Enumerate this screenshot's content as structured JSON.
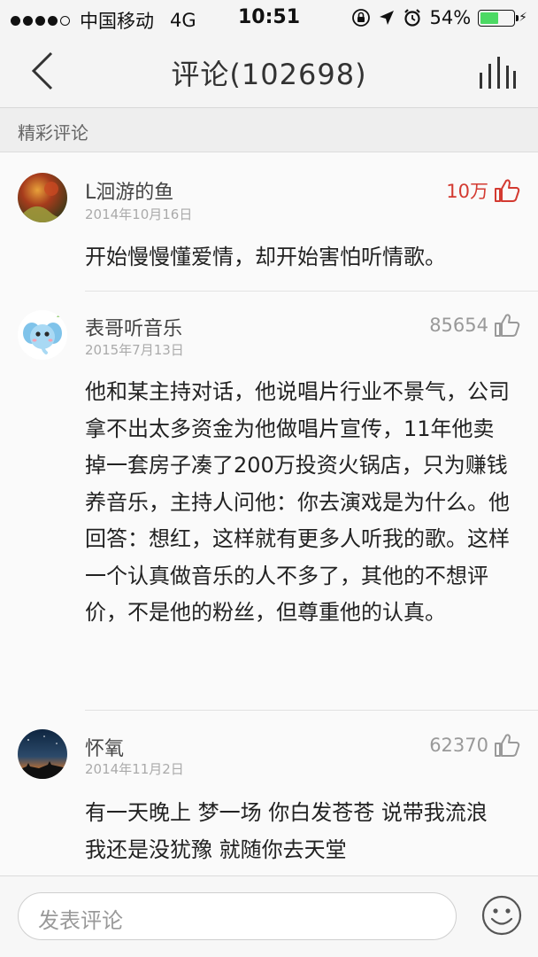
{
  "status_bar": {
    "carrier": "中国移动",
    "network": "4G",
    "time": "10:51",
    "battery_text": "54%",
    "battery_level": 0.54,
    "battery_color": "#4cd964"
  },
  "nav": {
    "back_icon": "chevron-left-icon",
    "title": "评论(102698)",
    "playing_icon": "now-playing-bars-icon"
  },
  "section": {
    "label": "精彩评论"
  },
  "comments": [
    {
      "user": "L洄游的鱼",
      "date": "2014年10月16日",
      "likes": "10万",
      "liked": true,
      "text": "开始慢慢懂爱情，却开始害怕听情歌。"
    },
    {
      "user": "表哥听音乐",
      "date": "2015年7月13日",
      "likes": "85654",
      "liked": false,
      "text": "他和某主持对话，他说唱片行业不景气，公司拿不出太多资金为他做唱片宣传，11年他卖掉一套房子凑了200万投资火锅店，只为赚钱养音乐，主持人问他：你去演戏是为什么。他回答：想红，这样就有更多人听我的歌。这样一个认真做音乐的人不多了，其他的不想评价，不是他的粉丝，但尊重他的认真。"
    },
    {
      "user": "怀氧",
      "date": "2014年11月2日",
      "likes": "62370",
      "liked": false,
      "text": "有一天晚上 梦一场 你白发苍苍 说带我流浪 我还是没犹豫 就随你去天堂"
    }
  ],
  "input_bar": {
    "placeholder": "发表评论",
    "emoji_icon": "smiley-face-icon"
  },
  "colors": {
    "accent_red": "#d33a31",
    "like_gray": "#999999"
  }
}
